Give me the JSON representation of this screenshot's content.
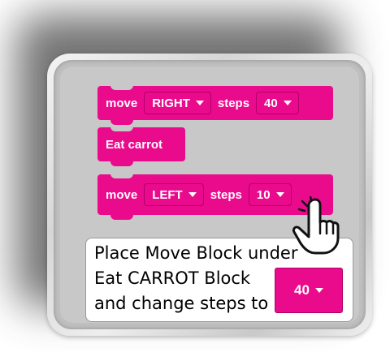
{
  "blocks": {
    "move_right": {
      "keyword": "move",
      "direction": "RIGHT",
      "steps_label": "steps",
      "steps_value": "40"
    },
    "eat": {
      "label": "Eat carrot"
    },
    "move_left": {
      "keyword": "move",
      "direction": "LEFT",
      "steps_label": "steps",
      "steps_value": "10"
    }
  },
  "instruction": {
    "line1": "Place Move Block under",
    "line2": "Eat CARROT Block",
    "line3": "and change steps to",
    "target_value": "40"
  },
  "icons": {
    "pointer": "hand-pointer-icon",
    "dropdown": "caret-down-icon"
  },
  "colors": {
    "block": "#ea0a8c",
    "panel": "#c8c8c8"
  }
}
